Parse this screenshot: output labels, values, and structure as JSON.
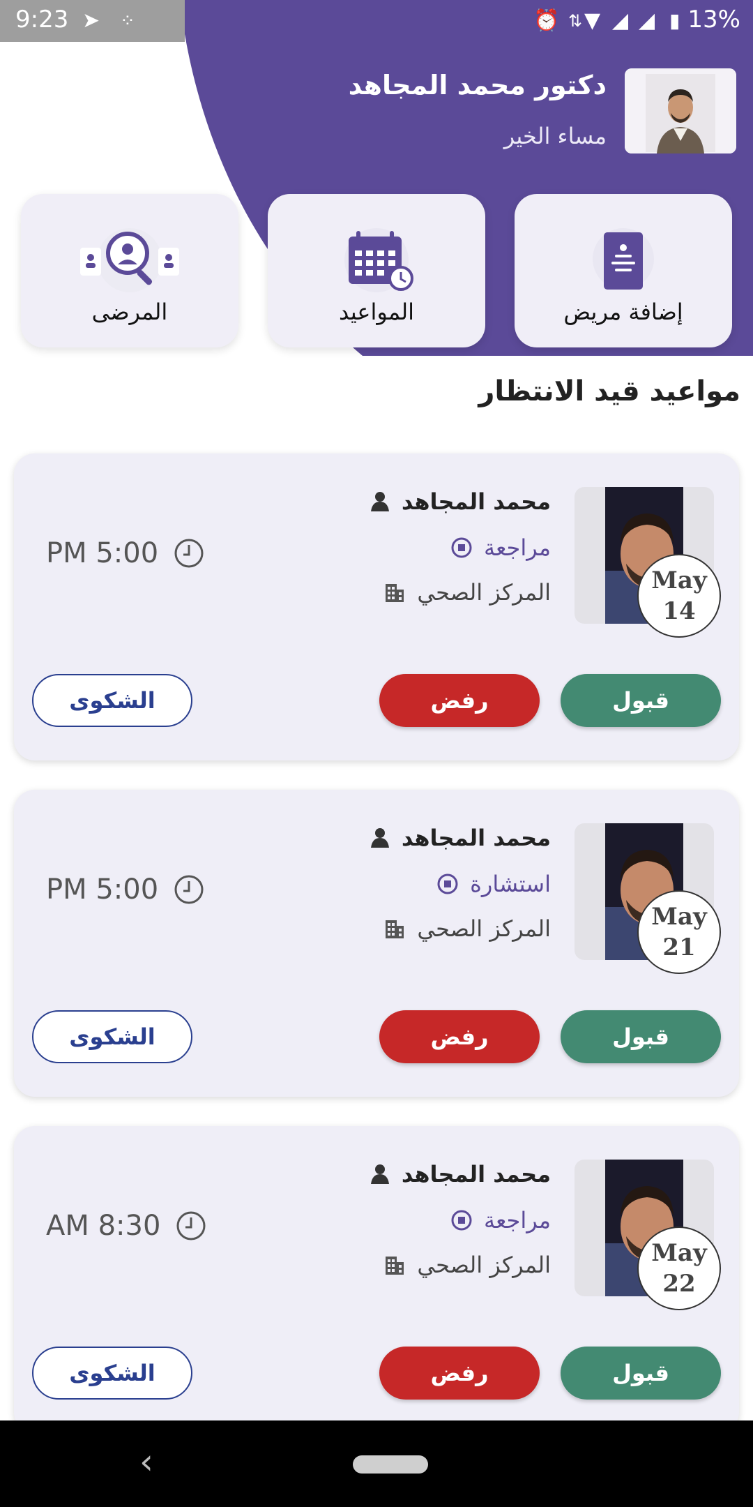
{
  "status_bar": {
    "time": "9:23",
    "battery_percent": "13%",
    "icons": [
      "telegram-icon",
      "assistant-icon",
      "alarm-icon",
      "data-arrows-icon",
      "wifi-icon",
      "signal-icon",
      "signal-x-icon",
      "battery-icon"
    ]
  },
  "header": {
    "doctor_name": "دكتور محمد المجاهد",
    "greeting": "مساء الخير"
  },
  "actions": [
    {
      "label": "إضافة مريض",
      "icon": "add-patient-icon"
    },
    {
      "label": "المواعيد",
      "icon": "calendar-icon"
    },
    {
      "label": "المرضى",
      "icon": "patients-search-icon"
    }
  ],
  "section_title": "مواعيد قيد الانتظار",
  "appointments": [
    {
      "name": "محمد المجاهد",
      "type": "مراجعة",
      "place": "المركز الصحي",
      "time": "PM 5:00",
      "month": "May",
      "day": "14",
      "accept": "قبول",
      "reject": "رفض",
      "complaint": "الشكوى"
    },
    {
      "name": "محمد المجاهد",
      "type": "استشارة",
      "place": "المركز الصحي",
      "time": "PM 5:00",
      "month": "May",
      "day": "21",
      "accept": "قبول",
      "reject": "رفض",
      "complaint": "الشكوى"
    },
    {
      "name": "محمد المجاهد",
      "type": "مراجعة",
      "place": "المركز الصحي",
      "time": "AM 8:30",
      "month": "May",
      "day": "22",
      "accept": "قبول",
      "reject": "رفض",
      "complaint": "الشكوى"
    }
  ],
  "colors": {
    "primary": "#5b4a98",
    "accept": "#438a72",
    "reject": "#c62828",
    "complaint": "#2a3f8f",
    "card": "#efeef7"
  }
}
